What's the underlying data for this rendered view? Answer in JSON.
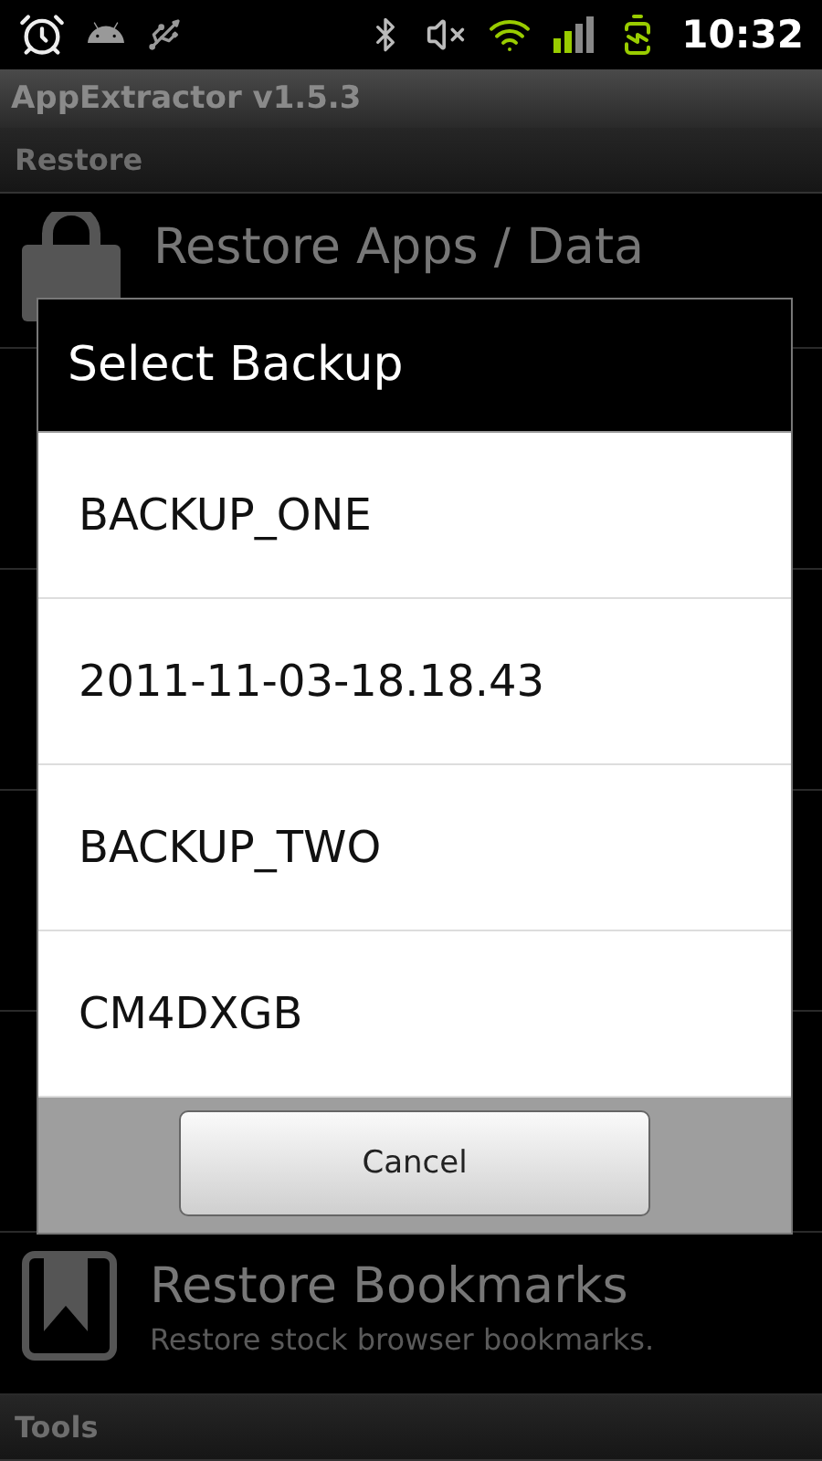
{
  "status_bar": {
    "time": "10:32"
  },
  "app_title": "AppExtractor v1.5.3",
  "sections": [
    {
      "header": "Restore",
      "items": [
        {
          "kind": "entry",
          "title": "Restore Apps / Data"
        },
        {
          "kind": "covered"
        },
        {
          "kind": "covered"
        },
        {
          "kind": "covered"
        },
        {
          "kind": "covered"
        },
        {
          "kind": "entry",
          "title": "Restore Bookmarks",
          "subtitle": "Restore stock browser bookmarks."
        }
      ]
    },
    {
      "header": "Tools"
    }
  ],
  "dialog": {
    "title": "Select Backup",
    "options": [
      "BACKUP_ONE",
      "2011-11-03-18.18.43",
      "BACKUP_TWO",
      "CM4DXGB"
    ],
    "button": "Cancel"
  }
}
